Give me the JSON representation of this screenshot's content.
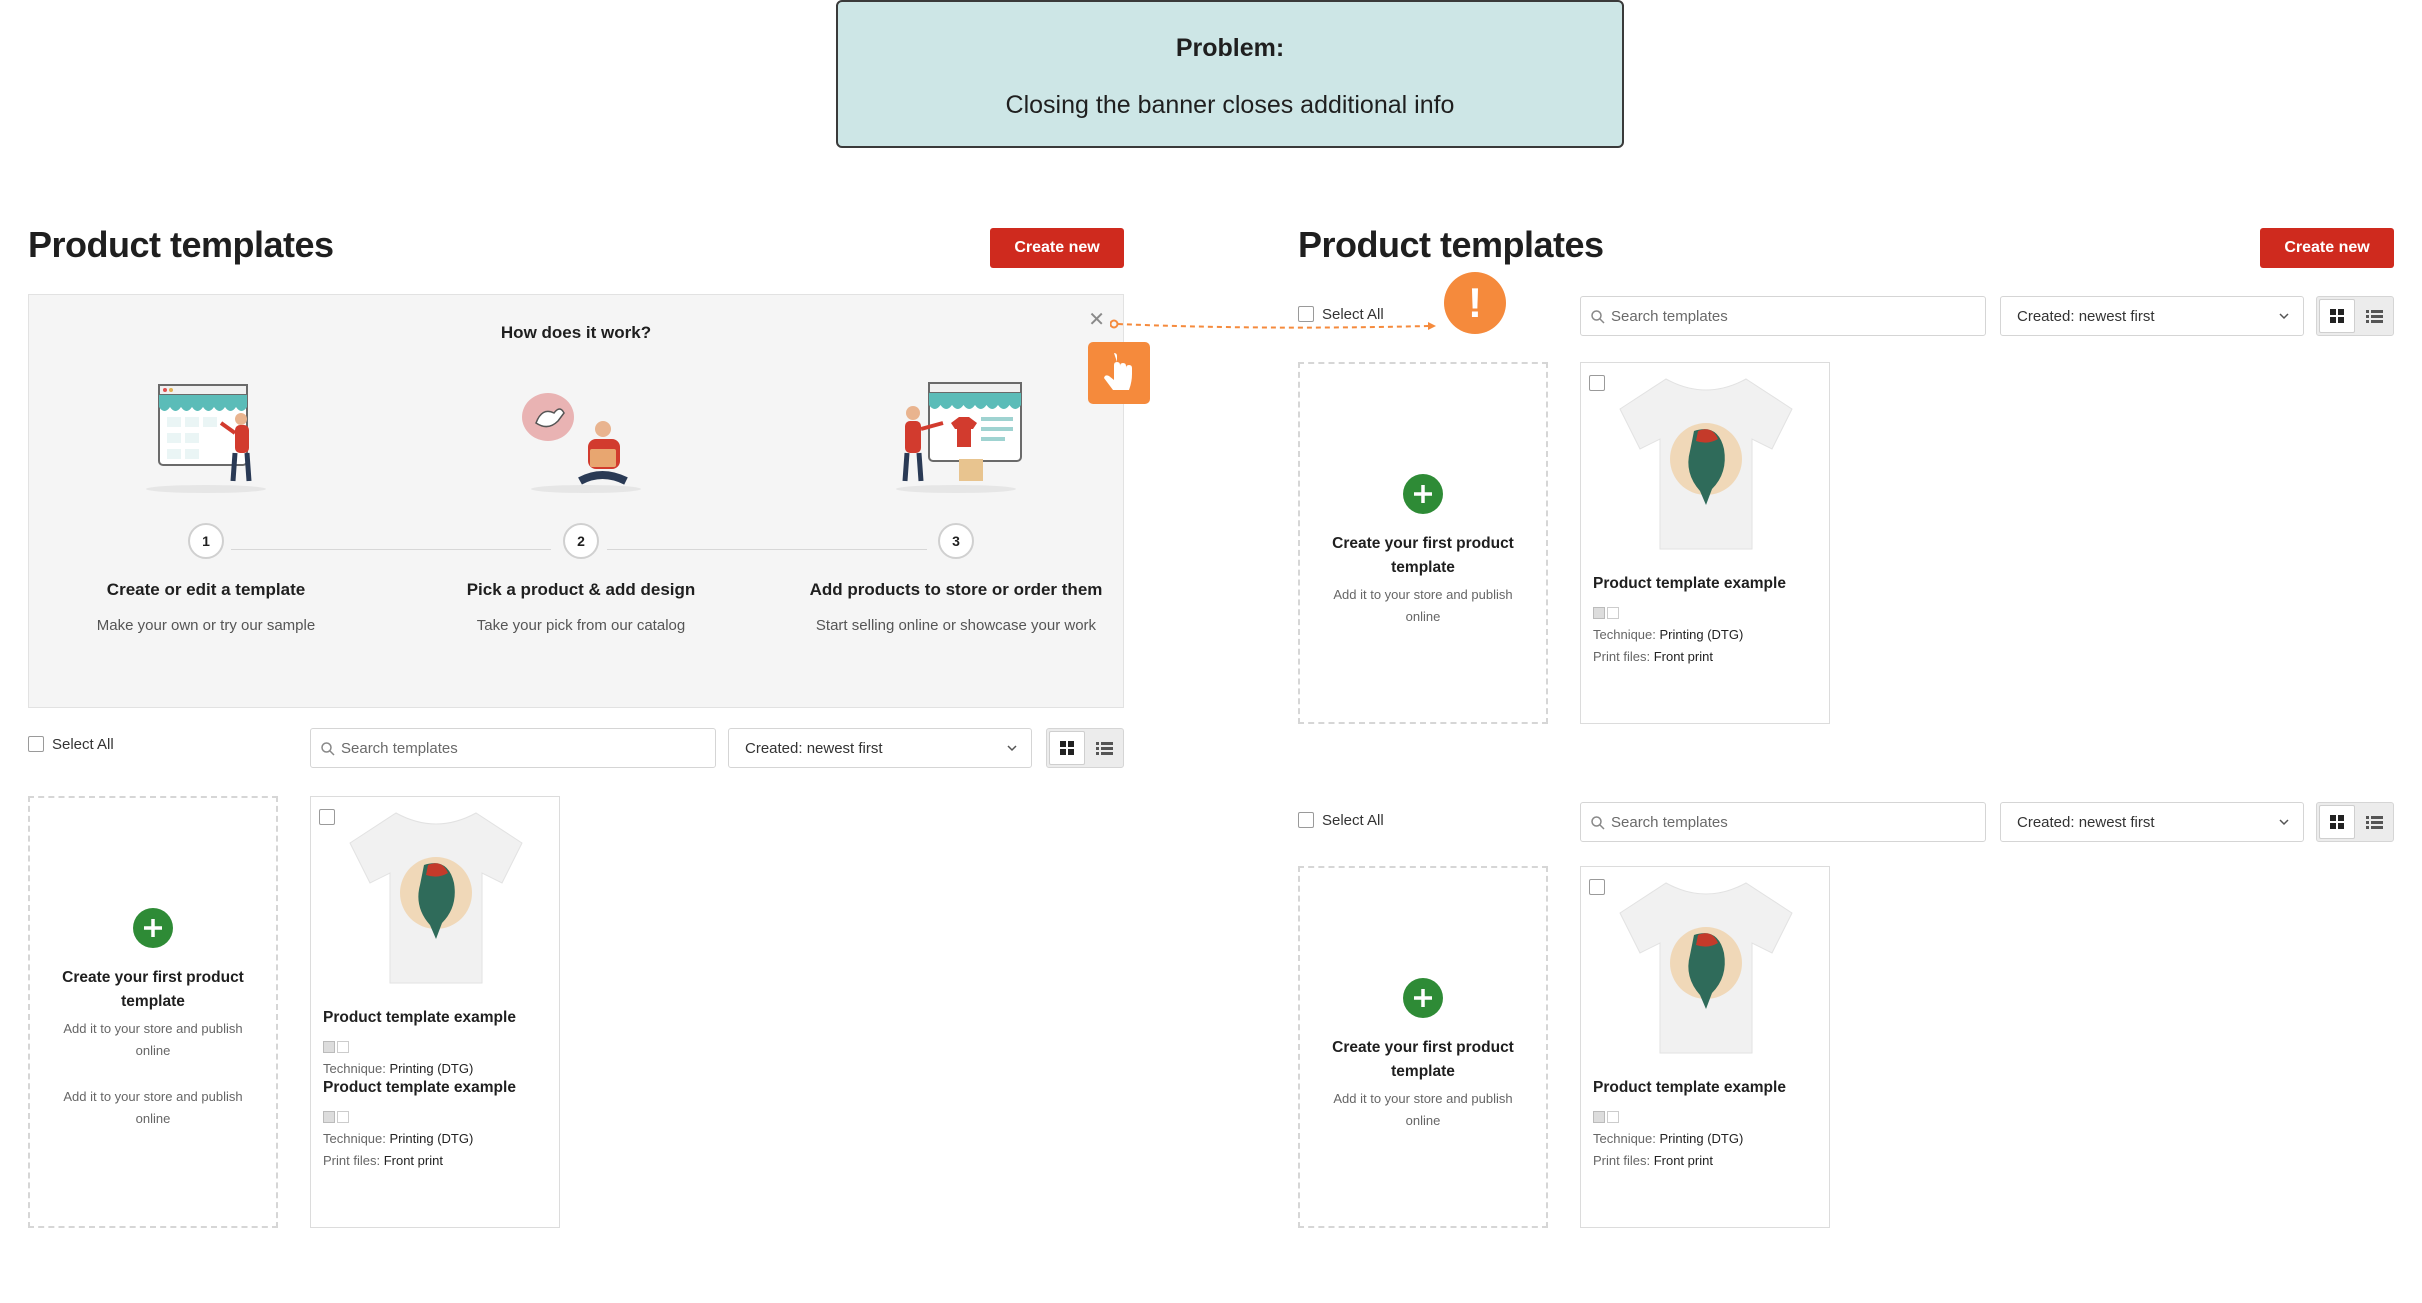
{
  "problem": {
    "heading": "Problem:",
    "text": "Closing the banner closes additional info"
  },
  "left": {
    "title": "Product templates",
    "create_label": "Create new",
    "banner": {
      "heading": "How does it work?",
      "close_icon": "close-icon",
      "steps": [
        {
          "num": "1",
          "title": "Create or edit a template",
          "desc": "Make your own or try our sample"
        },
        {
          "num": "2",
          "title": "Pick a product & add design",
          "desc": "Take your pick from our catalog"
        },
        {
          "num": "3",
          "title": "Add products to store or order them",
          "desc": "Start selling online or showcase your work"
        }
      ]
    },
    "toolbar": {
      "select_all": "Select All",
      "search_placeholder": "Search templates",
      "sort": "Created: newest first"
    },
    "new_card": {
      "title": "Create your first product template",
      "desc": "Add it to your store and publish online",
      "desc2": "Add it to your store and publish online"
    },
    "product_card": {
      "title": "Product template example",
      "technique_label": "Technique:",
      "technique": "Printing (DTG)",
      "title2": "Product template example",
      "technique_label2": "Technique:",
      "technique2": "Printing (DTG)",
      "files_label": "Print files:",
      "files": "Front print"
    }
  },
  "right": {
    "title": "Product templates",
    "create_label": "Create new",
    "panels": [
      {
        "toolbar": {
          "select_all": "Select All",
          "search_placeholder": "Search templates",
          "sort": "Created: newest first"
        },
        "new_card": {
          "title": "Create your first product template",
          "desc": "Add it to your store and publish online"
        },
        "product_card": {
          "title": "Product template example",
          "technique_label": "Technique:",
          "technique": "Printing (DTG)",
          "files_label": "Print files:",
          "files": "Front print"
        }
      },
      {
        "toolbar": {
          "select_all": "Select All",
          "search_placeholder": "Search templates",
          "sort": "Created: newest first"
        },
        "new_card": {
          "title": "Create your first product template",
          "desc": "Add it to your store and publish online"
        },
        "product_card": {
          "title": "Product template example",
          "technique_label": "Technique:",
          "technique": "Printing (DTG)",
          "files_label": "Print files:",
          "files": "Front print"
        }
      }
    ]
  },
  "colors": {
    "accent": "#cf2a1e",
    "plus": "#2e8b36",
    "annotation": "#f58a3c",
    "problem_bg": "#cde6e6"
  },
  "icons": [
    "search-icon",
    "chevron-down-icon",
    "grid-view-icon",
    "list-view-icon",
    "plus-icon",
    "close-icon",
    "tap-hand-icon",
    "warning-icon"
  ]
}
